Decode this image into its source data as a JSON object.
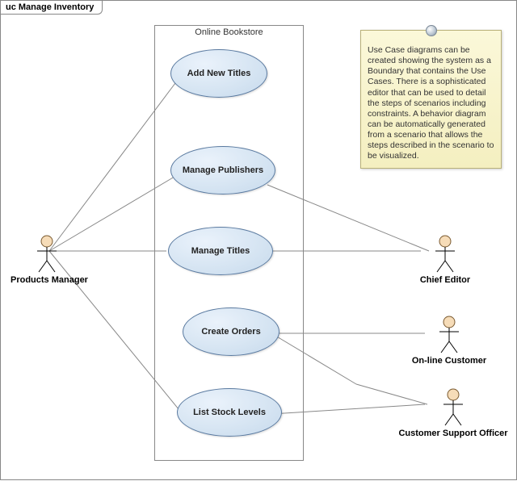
{
  "frame": {
    "title": "uc Manage Inventory"
  },
  "boundary": {
    "title": "Online Bookstore"
  },
  "usecases": {
    "add_new_titles": "Add New Titles",
    "manage_publishers": "Manage Publishers",
    "manage_titles": "Manage Titles",
    "create_orders": "Create Orders",
    "list_stock_levels": "List Stock Levels"
  },
  "actors": {
    "products_manager": "Products Manager",
    "chief_editor": "Chief Editor",
    "online_customer": "On-line Customer",
    "customer_support_officer": "Customer Support Officer"
  },
  "note": {
    "text": "Use Case diagrams can be created showing the system as a Boundary that contains the Use Cases. There is a sophisticated editor that can be used to detail the steps of scenarios including constraints. A behavior diagram can be automatically generated from a scenario that allows the steps described in the scenario to be visualized."
  }
}
